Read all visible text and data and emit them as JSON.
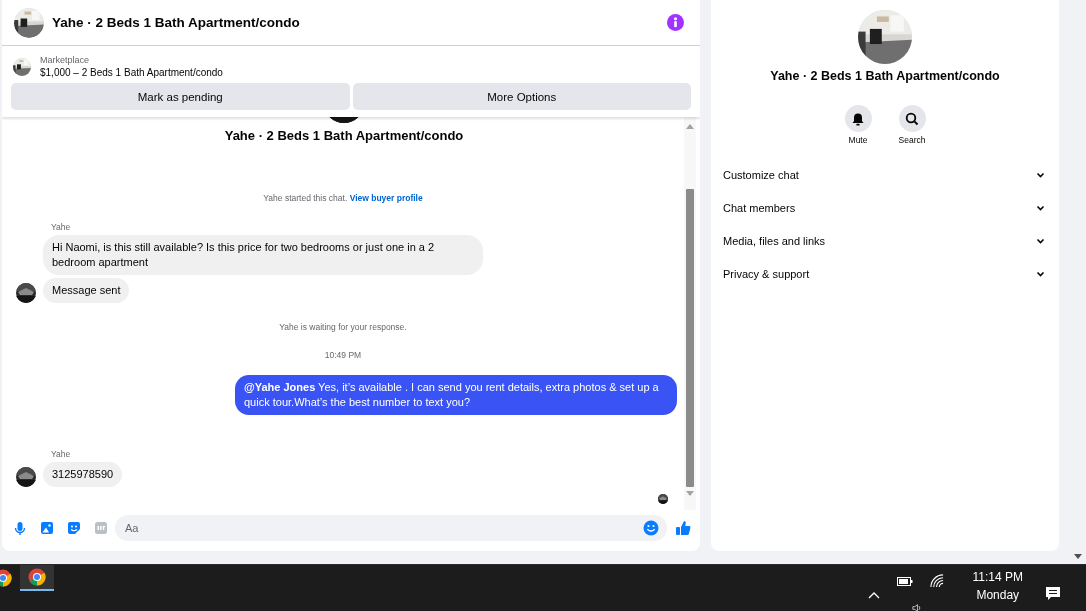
{
  "chat_header": {
    "title": "Yahe · 2 Beds 1 Bath Apartment/condo"
  },
  "listing": {
    "label": "Marketplace",
    "title": "$1,000 – 2 Beds 1 Bath Apartment/condo"
  },
  "actions": [
    "Mark as pending",
    "More Options"
  ],
  "conversation_title": "Yahe · 2 Beds 1 Bath Apartment/condo",
  "messages": [
    {
      "kind": "system",
      "text": "Yahe started this chat.",
      "link": "View buyer profile"
    },
    {
      "kind": "incoming",
      "sender": "Yahe",
      "bubbles": [
        "Hi Naomi, is this still available? Is this price for two bedrooms or just one in a 2 bedroom apartment",
        "Message sent"
      ]
    },
    {
      "kind": "system",
      "text": "Yahe is waiting for your response."
    },
    {
      "kind": "time",
      "text": "10:49 PM"
    },
    {
      "kind": "outgoing",
      "text": "**@Yahe Jones** Yes, it’s available .  I can send you rent details, extra photos & set up a quick tour.What’s the best number to text you?"
    },
    {
      "kind": "incoming",
      "sender": "Yahe",
      "bubbles": [
        "3125978590"
      ]
    }
  ],
  "composer": {
    "placeholder": "Aa"
  },
  "details": {
    "title": "Yahe · 2 Beds 1 Bath Apartment/condo",
    "actions": [
      {
        "kind": "mute",
        "label": "Mute"
      },
      {
        "kind": "search",
        "label": "Search"
      }
    ],
    "sections": [
      {
        "label": "Customize chat",
        "expanded": false
      },
      {
        "label": "Chat members",
        "expanded": false
      },
      {
        "label": "Media, files and links",
        "expanded": false
      },
      {
        "label": "Privacy & support",
        "expanded": false
      }
    ]
  },
  "taskbar": {
    "time": "11:14 PM",
    "day": "Monday"
  }
}
